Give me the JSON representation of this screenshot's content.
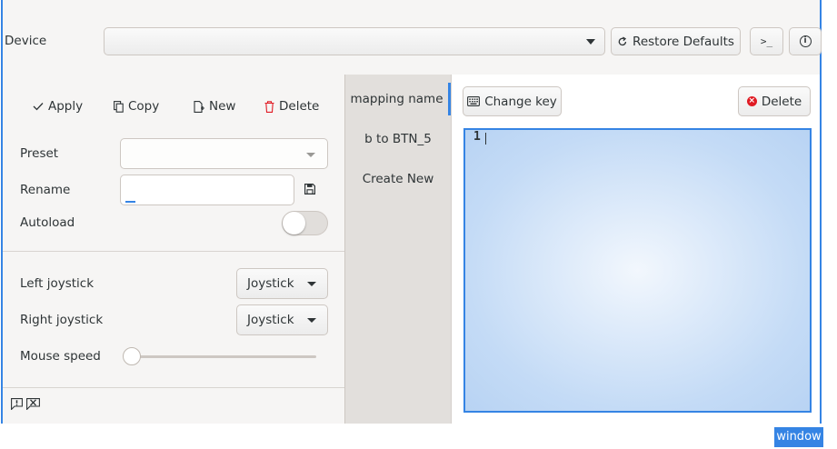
{
  "header": {
    "device_label": "Device",
    "device_value": "",
    "restore_label": "Restore Defaults",
    "terminal_glyph": ">_",
    "info_glyph": "i"
  },
  "preset_toolbar": {
    "apply_label": "Apply",
    "copy_label": "Copy",
    "new_label": "New",
    "delete_label": "Delete"
  },
  "preset_form": {
    "preset_label": "Preset",
    "preset_value": "",
    "rename_label": "Rename",
    "rename_value": "",
    "autoload_label": "Autoload",
    "autoload_on": false
  },
  "controls": {
    "left_joystick_label": "Left joystick",
    "left_joystick_value": "Joystick",
    "right_joystick_label": "Right joystick",
    "right_joystick_value": "Joystick",
    "mouse_speed_label": "Mouse speed",
    "mouse_speed_fraction": 0.0
  },
  "mappings": {
    "items": [
      {
        "label": "mapping name",
        "selected": true
      },
      {
        "label": "b to BTN_5",
        "selected": false
      },
      {
        "label": "Create New",
        "selected": false
      }
    ]
  },
  "editor": {
    "change_key_label": "Change key",
    "delete_label": "Delete",
    "line_number": "1"
  },
  "window_badge": "window",
  "colors": {
    "accent": "#3584e4",
    "danger": "#e01b24"
  }
}
